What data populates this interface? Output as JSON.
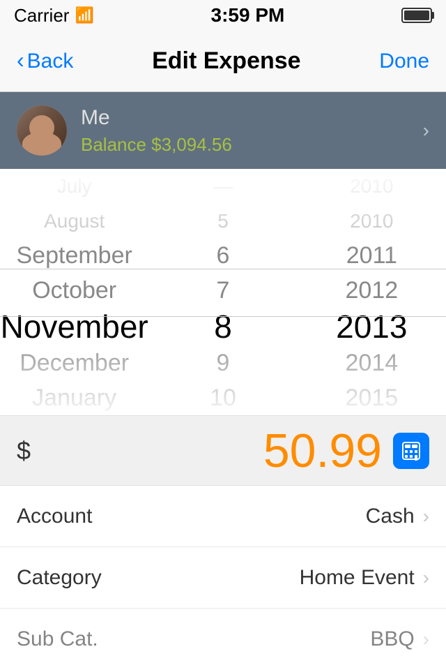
{
  "statusBar": {
    "carrier": "Carrier",
    "time": "3:59 PM"
  },
  "navBar": {
    "backLabel": "Back",
    "title": "Edit Expense",
    "doneLabel": "Done"
  },
  "accountHeader": {
    "name": "Me",
    "balance": "Balance $3,094.56"
  },
  "datePicker": {
    "months": [
      {
        "label": "July",
        "state": "far"
      },
      {
        "label": "August",
        "state": "faint"
      },
      {
        "label": "September",
        "state": "near"
      },
      {
        "label": "October",
        "state": "near"
      },
      {
        "label": "November",
        "state": "selected"
      },
      {
        "label": "December",
        "state": "near"
      },
      {
        "label": "January",
        "state": "near"
      }
    ],
    "days": [
      {
        "label": "—",
        "state": "far"
      },
      {
        "label": "5",
        "state": "faint"
      },
      {
        "label": "6",
        "state": "near"
      },
      {
        "label": "7",
        "state": "near"
      },
      {
        "label": "8",
        "state": "selected"
      },
      {
        "label": "9",
        "state": "near"
      },
      {
        "label": "10",
        "state": "near"
      }
    ],
    "years": [
      {
        "label": "2010",
        "state": "far"
      },
      {
        "label": "2010",
        "state": "faint"
      },
      {
        "label": "2011",
        "state": "near"
      },
      {
        "label": "2012",
        "state": "near"
      },
      {
        "label": "2013",
        "state": "selected"
      },
      {
        "label": "2014",
        "state": "near"
      },
      {
        "label": "2015",
        "state": "near"
      }
    ]
  },
  "amount": {
    "currencySymbol": "$",
    "value": "50.99"
  },
  "formRows": [
    {
      "label": "Account",
      "value": "Cash",
      "id": "account"
    },
    {
      "label": "Category",
      "value": "Home Event",
      "id": "category"
    },
    {
      "label": "Sub Cat.",
      "value": "BBQ",
      "id": "subcategory"
    }
  ]
}
